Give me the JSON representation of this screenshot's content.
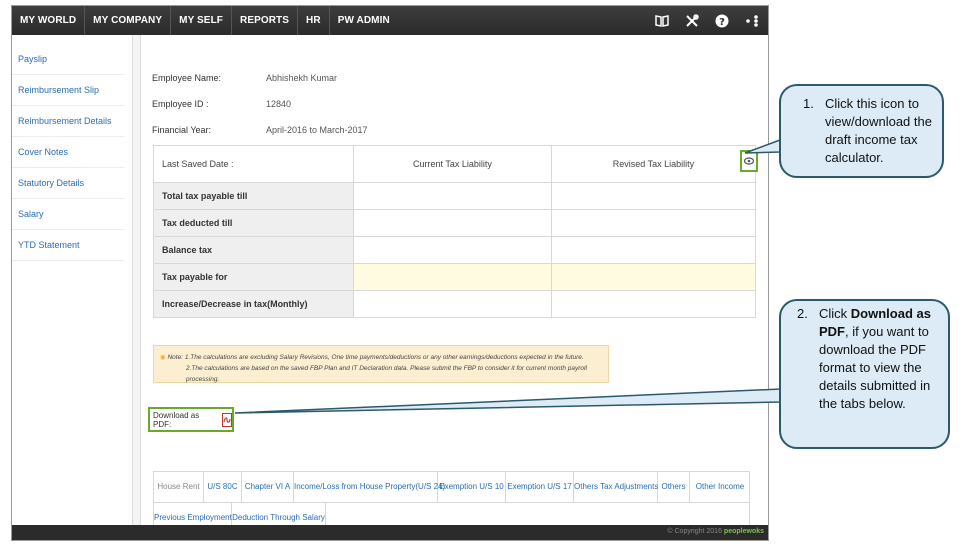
{
  "nav": {
    "items": [
      "MY WORLD",
      "MY COMPANY",
      "MY SELF",
      "REPORTS",
      "HR",
      "PW ADMIN"
    ],
    "icons": [
      "book-icon",
      "tools-icon",
      "help-icon",
      "share-icon"
    ]
  },
  "sidebar": {
    "items": [
      {
        "label": "Payslip"
      },
      {
        "label": "Reimbursement Slip"
      },
      {
        "label": "Reimbursement Details"
      },
      {
        "label": "Cover Notes"
      },
      {
        "label": "Statutory Details"
      },
      {
        "label": "Salary"
      },
      {
        "label": "YTD Statement"
      }
    ]
  },
  "employee": {
    "name_label": "Employee Name:",
    "name_value": "Abhishekh Kumar",
    "id_label": "Employee ID :",
    "id_value": "12840",
    "fy_label": "Financial Year:",
    "fy_value": "April-2016 to March-2017"
  },
  "tax_table": {
    "headers": [
      "Last Saved Date :",
      "Current Tax Liability",
      "Revised Tax Liability"
    ],
    "rows": [
      "Total tax payable till",
      "Tax deducted till",
      "Balance tax",
      "Tax payable for",
      "Increase/Decrease in tax(Monthly)"
    ]
  },
  "note": {
    "line1": "Note: 1.The calculations are excluding Salary Revisions, One time payments/deductions or any other earnings/deductions expected in the future.",
    "line2": "2.The calculations are based on the saved FBP Plan and IT Declaration data. Please submit the FBP to consider it for current month payroll processing."
  },
  "download": {
    "label": "Download as PDF:"
  },
  "tabs": {
    "row1": [
      "House Rent",
      "U/S 80C",
      "Chapter VI A",
      "Income/Loss from House Property(U/S 24)",
      "Exemption U/S 10",
      "Exemption U/S 17",
      "Others Tax Adjustments",
      "Others",
      "Other Income"
    ],
    "row2": [
      "Previous Employment",
      "Deduction Through Salary"
    ]
  },
  "footer": {
    "copyright": "© Copyright 2016",
    "brand": "peoplewoks"
  },
  "callouts": {
    "c1": {
      "num": "1.",
      "text": "Click this icon to view/download the draft income tax calculator."
    },
    "c2": {
      "num": "2.",
      "pre": "Click ",
      "bold": "Download as PDF",
      "post": ", if you want to download the PDF format to view the details submitted in the tabs below."
    }
  },
  "colors": {
    "nav_bg": "#2b2b2b",
    "link": "#2a6db5",
    "highlight_box": "#6aaa2a",
    "callout_bg": "#dcebf5",
    "callout_border": "#2c5a6b",
    "note_bg": "#fcefd1",
    "row_highlight": "#fffbe0"
  }
}
